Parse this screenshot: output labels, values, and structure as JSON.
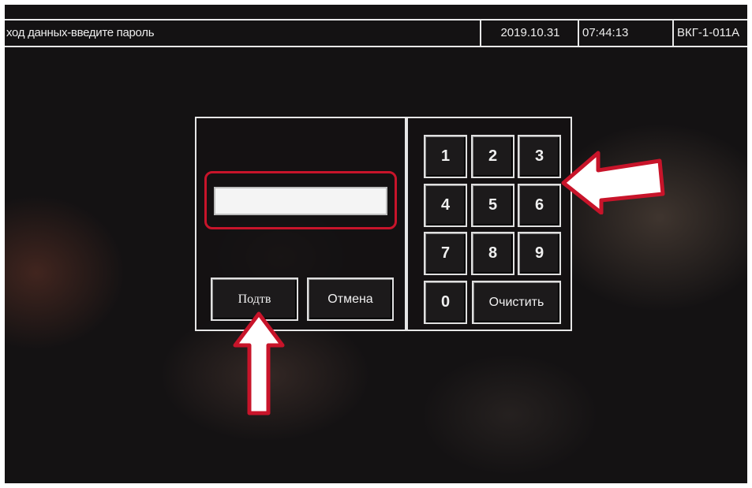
{
  "header": {
    "title": "ход данных-введите пароль",
    "date": "2019.10.31",
    "time": "07:44:13",
    "device": "ВКГ-1-011А"
  },
  "login": {
    "password_value": "",
    "confirm_label": "Подтв",
    "cancel_label": "Отмена"
  },
  "keypad": {
    "keys": [
      "1",
      "2",
      "3",
      "4",
      "5",
      "6",
      "7",
      "8",
      "9",
      "0"
    ],
    "clear_label": "Очистить"
  },
  "colors": {
    "background": "#141213",
    "panel_border": "#e6e6e6",
    "highlight": "#c8142a",
    "arrow_fill": "#ffffff",
    "arrow_outline": "#c8142a"
  },
  "icons": {
    "annotation_arrow_keypad": "arrow-left-icon",
    "annotation_arrow_confirm": "arrow-up-icon"
  }
}
